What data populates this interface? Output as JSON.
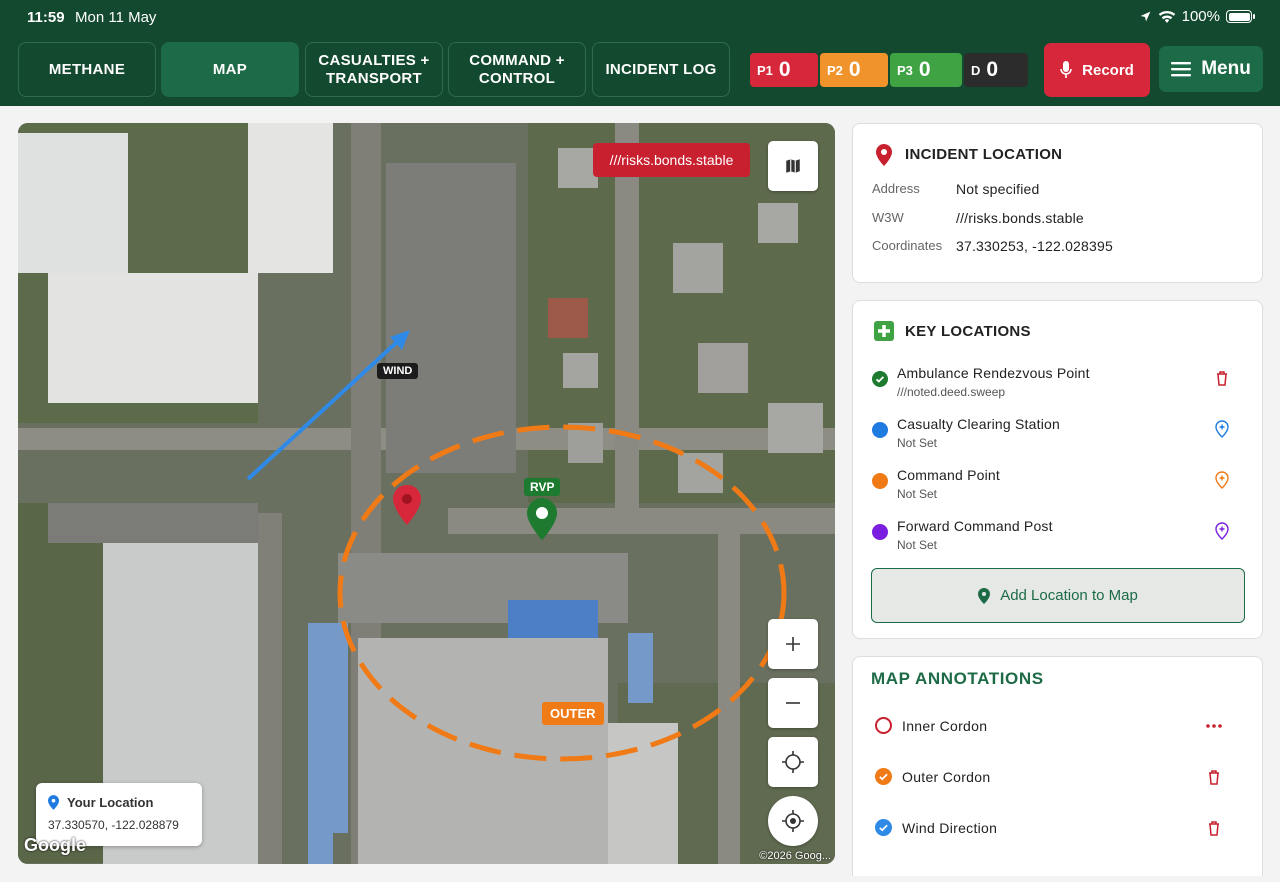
{
  "status": {
    "time": "11:59",
    "date": "Mon 11 May",
    "battery": "100%"
  },
  "tabs": [
    {
      "label": "METHANE"
    },
    {
      "label": "MAP"
    },
    {
      "label": "CASUALTIES +\nTRANSPORT"
    },
    {
      "label": "COMMAND +\nCONTROL"
    },
    {
      "label": "INCIDENT LOG"
    }
  ],
  "priorities": [
    {
      "label": "P1",
      "count": "0",
      "color": "#d6283a"
    },
    {
      "label": "P2",
      "count": "0",
      "color": "#f0932b"
    },
    {
      "label": "P3",
      "count": "0",
      "color": "#3fa243"
    },
    {
      "label": "D",
      "count": "0",
      "color": "#2c2c2c"
    }
  ],
  "record_label": "Record",
  "menu_label": "Menu",
  "map": {
    "w3w_badge": "///risks.bonds.stable",
    "wind_label": "WIND",
    "rvp_label": "RVP",
    "outer_label": "OUTER",
    "your_location_title": "Your Location",
    "your_location_coords": "37.330570, -122.028879",
    "google_logo": "Google",
    "copyright": "©2026 Goog..."
  },
  "incident": {
    "title": "INCIDENT LOCATION",
    "address_label": "Address",
    "address_value": "Not specified",
    "w3w_label": "W3W",
    "w3w_value": "///risks.bonds.stable",
    "coords_label": "Coordinates",
    "coords_value": "37.330253, -122.028395"
  },
  "key_locations": {
    "title": "KEY LOCATIONS",
    "items": [
      {
        "name": "Ambulance Rendezvous Point",
        "sub": "///noted.deed.sweep",
        "color": "#1d7a2f",
        "action": "trash-icon"
      },
      {
        "name": "Casualty Clearing Station",
        "sub": "Not Set",
        "color": "#1f7be0",
        "action": "add-pin-icon"
      },
      {
        "name": "Command Point",
        "sub": "Not Set",
        "color": "#f07a16",
        "action": "add-pin-icon"
      },
      {
        "name": "Forward Command Post",
        "sub": "Not Set",
        "color": "#7a1fe0",
        "action": "add-pin-icon"
      }
    ],
    "add_button": "Add Location to Map"
  },
  "annotations": {
    "title": "MAP ANNOTATIONS",
    "items": [
      {
        "name": "Inner Cordon",
        "color": "#c8202e",
        "style": "outline",
        "action": "dots-icon"
      },
      {
        "name": "Outer Cordon",
        "color": "#f07a16",
        "style": "check",
        "action": "trash-icon"
      },
      {
        "name": "Wind Direction",
        "color": "#1f7be0",
        "style": "check",
        "action": "trash-icon"
      }
    ]
  }
}
